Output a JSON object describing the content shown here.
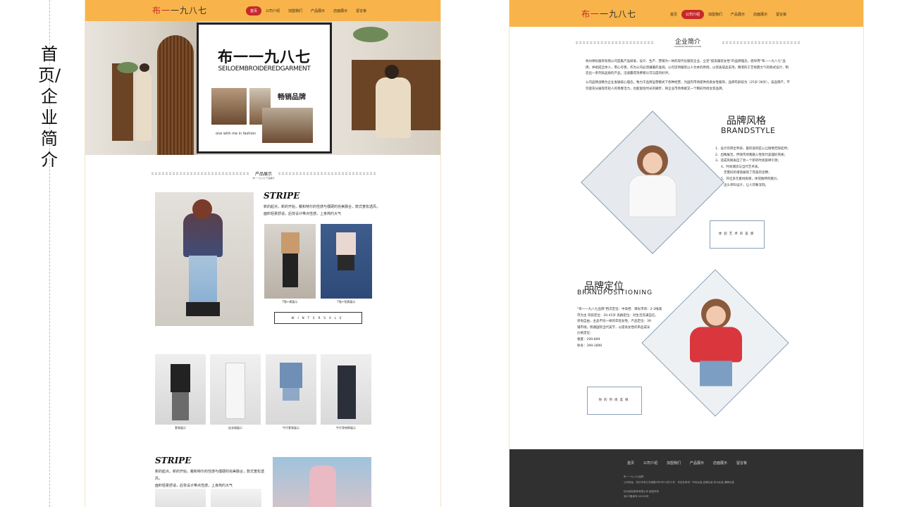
{
  "caption": {
    "vertical_title": "首页/企业简介"
  },
  "home": {
    "logo": {
      "red": "布一",
      "dark": "一九八七"
    },
    "nav": [
      "首页",
      "公司介绍",
      "加盟我们",
      "产品展示",
      "店面展示",
      "留言板"
    ],
    "hero": {
      "brand": "布一一九八七",
      "brand_en": "SEILOEMBROIDEREDGARMENT",
      "tagline": "畅销品牌",
      "small_text": "one with me in fashion"
    },
    "products_section": {
      "title": "产品展示",
      "subtitle": "布一一九八七 产品展示"
    },
    "stripe1": {
      "heading": "STRIPE",
      "body_line1": "新的起点，新的开始，戴和特尔的性感与僵硬的完美融合，款式宽松透风，",
      "body_line2": "面料轻柔舒适，后背设计带点性感，上身简约大气",
      "cap1": "T恤+裤展示",
      "cap2": "T恤+短裤展示",
      "button": "WINTERSALE"
    },
    "gallery": [
      "套装展示",
      "连衣裙展示",
      "牛仔套装展示",
      "牛仔背带裤展示"
    ],
    "stripe2": {
      "heading": "STRIPE",
      "body_line1": "新的起点，新的开始，戴和特尔的性感与僵硬的完美融合，款式宽松透风，",
      "body_line2": "面料轻柔舒适，后背设计带点性感，上身简约大气"
    }
  },
  "about": {
    "logo": {
      "red": "布一",
      "dark": "一九八七"
    },
    "nav": [
      "首页",
      "公司介绍",
      "加盟我们",
      "产品展示",
      "店面展示",
      "留言板"
    ],
    "intro": {
      "title": "企业简介",
      "subtitle": "COMPANYINTRODUCTION",
      "p1": "杭州保标服饰有限公司是集产品研发、设计、生产、营销为一体的现代化服装企业，立足“提高服装女性”的品牌理念，倡导用“布一一九八七”品牌，并组成全体人，用心尽善，作为公司必须遵循的准则。公司坚持服装以人为本的原则，以优质成品支持，精湛的工艺经典大气的款式设计，制造出一系列高品质的产品，迅速赢得消费者认可与度的好评。",
      "p2": "公司品牌战略为企业发展核心理念，致力于品牌运营模式下各种经营，为国内市场提供优质女性服饰，品牌年龄段为（25岁-38岁），该品牌产，不仅能充分展现年轻人的青春活力，也能留住时光的脚步，将企业市场奉献又一个精彩时尚女装品牌。"
    },
    "brandstyle": {
      "cn": "品牌风格",
      "en": "BRANDSTYLE",
      "items": [
        "1、设计的突出专研，着的宽的匠心让微情无限延伸；",
        "2、出精展活，伴随市场我融入性现代美理好风格；",
        "3、造成风格再自了另一个新的时尚旋律引领；",
        "4、时尚潮流与当代艺术表。",
        "无需同的诸谐展现了完美的诠释；",
        "5、开启多元素材质感，体现独特的魅力，",
        "出头单科设计，让人印象深刻。"
      ],
      "button": "体验艺术的美感"
    },
    "positioning": {
      "cn": "品牌定位",
      "en": "BRANDPOSITIONING",
      "lines": [
        "“布一一九八七品牌”档次定位：中高档　目标市场：2-3线城",
        "市为主 年龄定位：20-45岁 高群定位：对生活充满自信，",
        "崇尚自由，主品不同一样的年轻女性，产品定位：39",
        "铺市线，侧通国际当代美学，以提高女性的审品成长",
        "价格定位：",
        "春夏：299-899",
        "秋冬：399-1899"
      ],
      "button": "你的时尚选择"
    },
    "footer": {
      "nav": [
        "首页",
        "公司介绍",
        "加盟我们",
        "产品展示",
        "店面展示",
        "留言板"
      ],
      "line1": "布一一九八七品牌",
      "line2": "公司地址：杭州市浙江东路路5号9号11层15号　本站名单词：时尚女装 品牌女装 杭州女装 潮牌女装",
      "line3": "杭州保标服饰有限公司 版权所有",
      "line4": "浙ICP备案号:00000号"
    }
  },
  "colors": {
    "accent_orange": "#f8b44a",
    "accent_red": "#c8282a",
    "footer_dark": "#303030",
    "diamond_border": "#8aa0b8"
  }
}
